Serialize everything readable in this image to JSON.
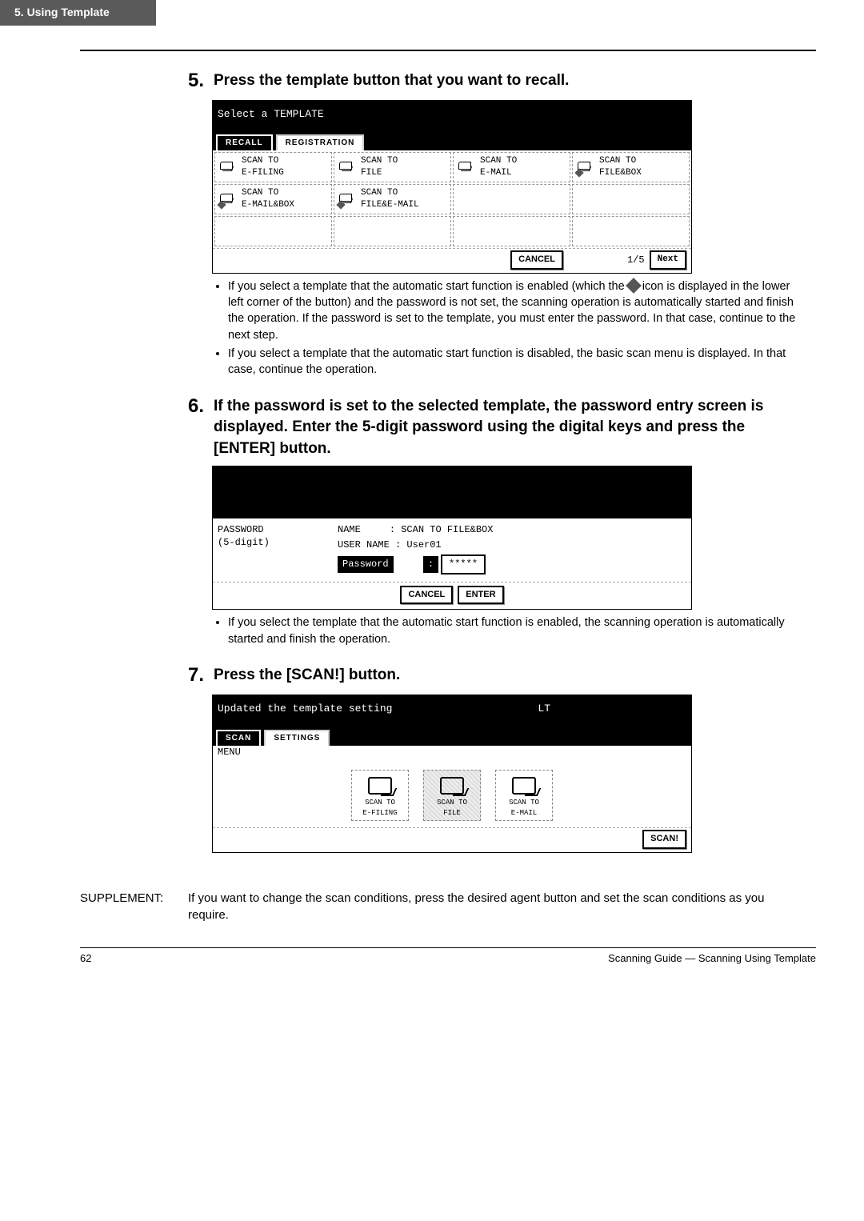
{
  "header": {
    "chapter": "5. Using Template"
  },
  "steps": {
    "s5": {
      "num": "5.",
      "heading": "Press the template button that you want to recall."
    },
    "s6": {
      "num": "6.",
      "heading": "If the password is set to the selected template, the password entry screen is displayed.  Enter the 5-digit password using the digital keys and press the [ENTER] button."
    },
    "s7": {
      "num": "7.",
      "heading": "Press the [SCAN!] button."
    }
  },
  "shot1": {
    "title": "Select a TEMPLATE",
    "tabs": {
      "active": "RECALL",
      "inactive": "REGISTRATION"
    },
    "cells": [
      "SCAN TO\nE-FILING",
      "SCAN TO\nFILE",
      "SCAN TO\nE-MAIL",
      "SCAN TO\nFILE&BOX",
      "SCAN TO\nE-MAIL&BOX",
      "SCAN TO\nFILE&E-MAIL",
      "",
      "",
      "",
      "",
      "",
      ""
    ],
    "cancel": "CANCEL",
    "page": "1/5",
    "next": "Next"
  },
  "bullets5": {
    "b1a": "If you select a template that the automatic start function is enabled (which the ",
    "b1b": " icon is displayed in the lower left corner of the button) and the password is not set, the scanning operation is automatically started and finish the operation.  If the password is set to the template, you must enter the password.  In that case, continue to the next step.",
    "b2": "If you select a template that the automatic start function is disabled, the basic scan menu is displayed.  In that case, continue the operation."
  },
  "shot2": {
    "left1": "PASSWORD",
    "left2": "(5-digit)",
    "name_label": "NAME",
    "name_value": ": SCAN TO FILE&BOX",
    "user_label": "USER NAME",
    "user_value": ": User01",
    "pw_label": "Password",
    "pw_colon": ":",
    "pw_value": "*****",
    "cancel": "CANCEL",
    "enter": "ENTER"
  },
  "bullets6": {
    "b1": "If you select the template that the automatic start function is enabled, the scanning operation is automatically started and finish the operation."
  },
  "shot3": {
    "title_left": "Updated the template setting",
    "title_right": "LT",
    "tabs": {
      "active": "SCAN",
      "inactive": "SETTINGS"
    },
    "menu_label": "MENU",
    "items": [
      "SCAN TO\nE-FILING",
      "SCAN TO\nFILE",
      "SCAN TO\nE-MAIL"
    ],
    "scan_btn": "SCAN!"
  },
  "supplement": {
    "label": "SUPPLEMENT:",
    "text": "If you want to change the scan conditions, press the desired agent button and set the scan conditions as you require."
  },
  "footer": {
    "page": "62",
    "right": "Scanning Guide — Scanning Using Template"
  }
}
